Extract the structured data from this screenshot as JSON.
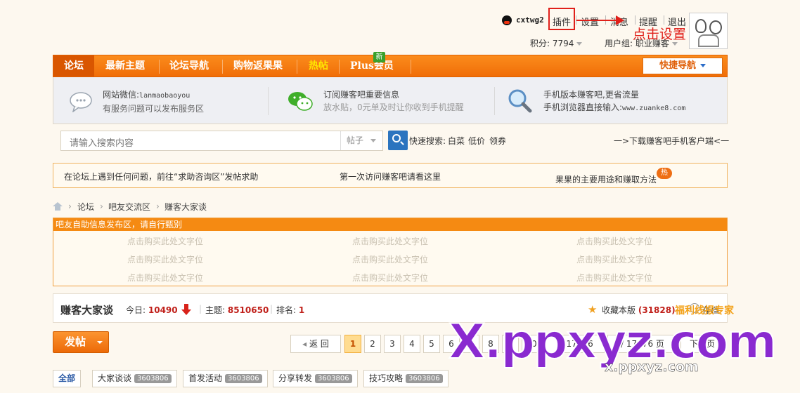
{
  "user_bar": {
    "username": "cxtwg2",
    "links": [
      "插件",
      "设置",
      "消息",
      "提醒",
      "退出"
    ],
    "score_label": "积分: 7794",
    "group_label": "用户组: 职业赚客",
    "annotation": "点击设置",
    "annotation_color": "#e0201a"
  },
  "nav": {
    "items": [
      "论坛",
      "最新主题",
      "论坛导航",
      "购物返果果",
      "热帖",
      "Plus会员"
    ],
    "new_badge": "新",
    "quick_nav": "快捷导航",
    "accent": "#f27a10"
  },
  "info": {
    "blocks": [
      {
        "title": "网站微信:",
        "title_extra": "lanmaobaoyou",
        "sub": "有服务问题可以发布服务区"
      },
      {
        "title": "订阅赚客吧重要信息",
        "sub": "放水贴，0元单及时让你收到手机提醒"
      },
      {
        "title": "手机版本赚客吧,更省流量",
        "sub": "手机浏览器直接输入:",
        "sub_extra": "www.zuanke8.com"
      }
    ]
  },
  "search": {
    "placeholder": "请输入搜索内容",
    "type": "帖子",
    "quick_label": "快速搜索:",
    "quick_terms": [
      "白菜",
      "低价",
      "领券"
    ],
    "download": "一>下载赚客吧手机客户端<一"
  },
  "notices": [
    "在论坛上遇到任何问题，前往“求助咨询区”发帖求助",
    "第一次访问赚客吧请看这里",
    "果果的主要用途和赚取方法",
    "热"
  ],
  "breadcrumb": [
    "论坛",
    "吧友交流区",
    "赚客大家谈"
  ],
  "adbox": {
    "header": "吧友自助信息发布区，请自行甄别",
    "cell": "点击购买此处文字位"
  },
  "forum": {
    "name": "赚客大家谈",
    "today_label": "今日:",
    "today": "10490",
    "topics_label": "主题:",
    "topics": "8510650",
    "rank_label": "排名:",
    "rank": "1",
    "fav_label": "收藏本版",
    "fav_count": "(31828)",
    "archive": "存档"
  },
  "post_button": "发帖",
  "pagination": {
    "back": "返 回",
    "pages": [
      "1",
      "2",
      "3",
      "4",
      "5",
      "6",
      "7",
      "8",
      "9",
      "10"
    ],
    "ellipsis": "... 17276",
    "goto": "/ 17276 页",
    "next": "下一页"
  },
  "tabs": [
    {
      "label": "全部"
    },
    {
      "label": "大家谈谈",
      "count": "3603806"
    },
    {
      "label": "首发活动",
      "count": "3603806"
    },
    {
      "label": "分享转发",
      "count": "3603806"
    },
    {
      "label": "技巧攻略",
      "count": "3603806"
    }
  ],
  "watermark": {
    "text": "X.ppxyz.com",
    "sub": "x.ppxyz.com",
    "logo": "福利线报专家"
  }
}
